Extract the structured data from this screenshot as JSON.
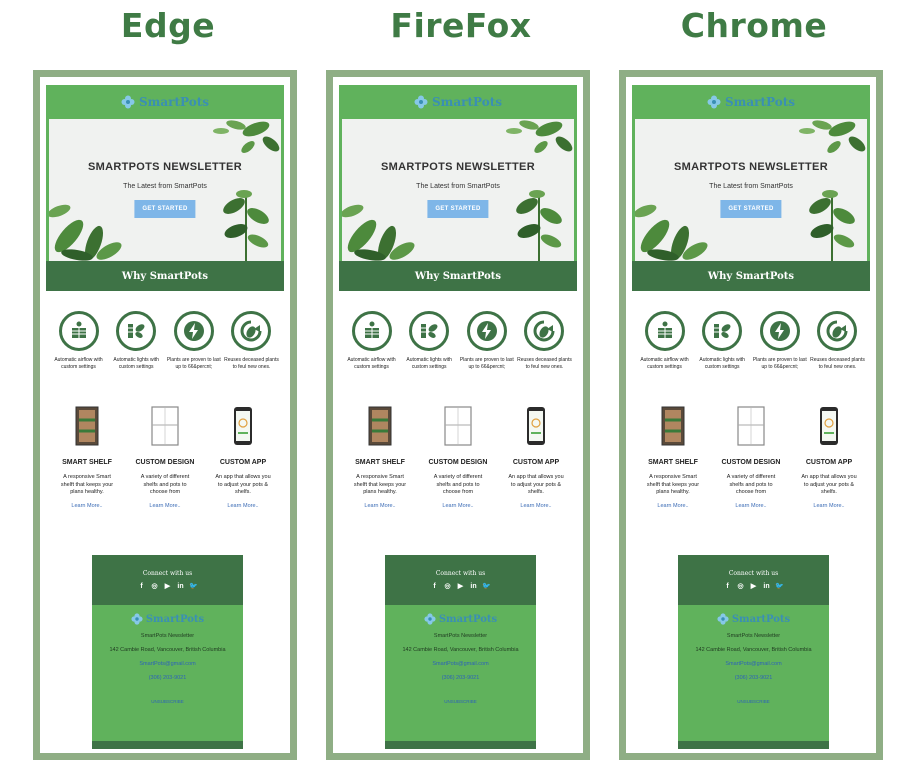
{
  "browsers": [
    {
      "name": "Edge"
    },
    {
      "name": "FireFox"
    },
    {
      "name": "Chrome"
    }
  ],
  "email": {
    "logo_text": "SmartPots",
    "hero": {
      "title": "SMARTPOTS NEWSLETTER",
      "subtitle": "The Latest from SmartPots",
      "button": "GET STARTED"
    },
    "why_title": "Why SmartPots",
    "features": [
      {
        "icon": "airflow-icon",
        "text": "Automatic airflow with custom settings"
      },
      {
        "icon": "plant-light-icon",
        "text": "Automatic lights with custom settings"
      },
      {
        "icon": "lightning-icon",
        "text": "Plants are proven to last up to 66&percnt;"
      },
      {
        "icon": "recycle-leaf-icon",
        "text": "Reuses deceased plants to feul new ones."
      }
    ],
    "products": [
      {
        "name": "SMART SHELF",
        "desc": "A responsive Smart shelft that keeps your plans healthy.",
        "link": "Learn More.."
      },
      {
        "name": "CUSTOM DESIGN",
        "desc": "A variety of different shelfs and pots to choose from",
        "link": "Learn More.."
      },
      {
        "name": "CUSTOM APP",
        "desc": "An app that allows you to adjust your pots & shelfs.",
        "link": "Learn More.."
      }
    ],
    "footer": {
      "connect": "Connect with us",
      "socials": [
        "f",
        "◎",
        "▶",
        "in",
        "🐦"
      ],
      "logo_text": "SmartPots",
      "newsletter": "SmartPots Newsletter",
      "address": "142 Cambie Road, Vancouver, British Columbia",
      "email": "SmartPots@gmail.com",
      "phone": "(306) 203-9021",
      "unsubscribe": "UNSUBSCRIBE"
    }
  },
  "colors": {
    "green": "#60b25c",
    "dark_green": "#3e7346",
    "frame": "#8fae85",
    "title": "#3f7b45"
  }
}
